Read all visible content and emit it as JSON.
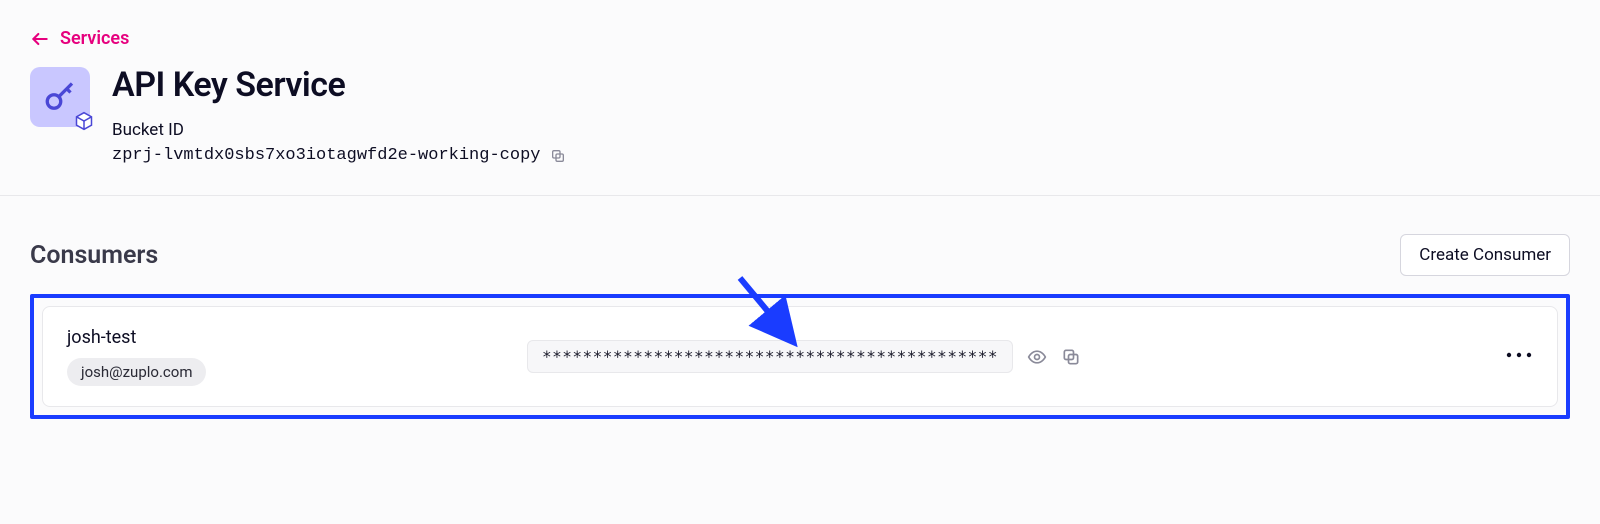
{
  "breadcrumb": {
    "back_label": "Services"
  },
  "header": {
    "title": "API Key Service",
    "bucket_label": "Bucket ID",
    "bucket_id": "zprj-lvmtdx0sbs7xo3iotagwfd2e-working-copy"
  },
  "consumers": {
    "title": "Consumers",
    "create_label": "Create Consumer",
    "items": [
      {
        "name": "josh-test",
        "email": "josh@zuplo.com",
        "masked_key": "*********************************************"
      }
    ]
  }
}
